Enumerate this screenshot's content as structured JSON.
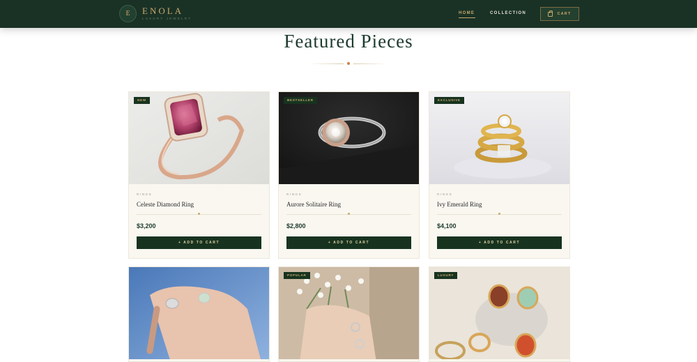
{
  "brand": {
    "initial": "E",
    "name": "ENOLA",
    "tagline": "LUXURY JEWELRY"
  },
  "nav": {
    "home": "HOME",
    "collection": "COLLECTION",
    "cart": "CART"
  },
  "section": {
    "title": "Featured Pieces"
  },
  "colors": {
    "header": "#1a3226",
    "gold": "#c9a96e",
    "card": "#f9f7f0",
    "button": "#17331f",
    "accent_dot": "#c9844a"
  },
  "products": [
    {
      "badge": "NEW",
      "category": "RINGS",
      "name": "Celeste Diamond Ring",
      "price": "$3,200",
      "cta": "+ ADD TO CART"
    },
    {
      "badge": "BESTSELLER",
      "category": "RINGS",
      "name": "Aurore Solitaire Ring",
      "price": "$2,800",
      "cta": "+ ADD TO CART"
    },
    {
      "badge": "EXCLUSIVE",
      "category": "RINGS",
      "name": "Ivy Emerald Ring",
      "price": "$4,100",
      "cta": "+ ADD TO CART"
    },
    {
      "badge": ""
    },
    {
      "badge": "POPULAR"
    },
    {
      "badge": "LUXURY"
    }
  ]
}
